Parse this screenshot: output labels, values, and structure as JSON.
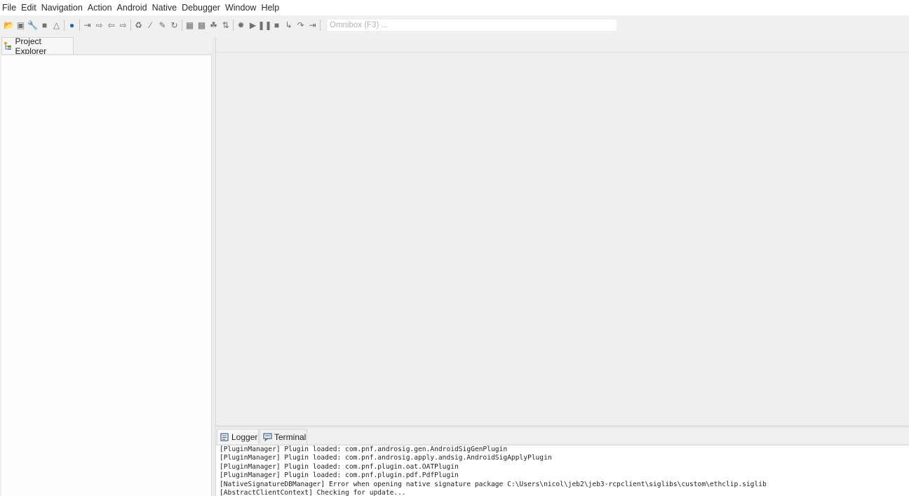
{
  "menu": {
    "items": [
      {
        "label": "File"
      },
      {
        "label": "Edit"
      },
      {
        "label": "Navigation"
      },
      {
        "label": "Action"
      },
      {
        "label": "Android"
      },
      {
        "label": "Native"
      },
      {
        "label": "Debugger"
      },
      {
        "label": "Window"
      },
      {
        "label": "Help"
      }
    ]
  },
  "toolbar": {
    "icons": [
      "open-icon",
      "save-icon",
      "wrench-icon",
      "close-project-icon",
      "properties-icon",
      "globe-icon",
      "step-in-icon",
      "step-over-icon",
      "back-icon",
      "forward-icon",
      "rename-icon",
      "comment-icon",
      "edit-icon",
      "refresh-icon",
      "grid-icon",
      "graph-icon",
      "tree-icon",
      "sort-icon",
      "debug-icon",
      "run-icon",
      "pause-icon",
      "stop-icon",
      "step-into-icon",
      "step-over-debug-icon",
      "step-return-icon"
    ],
    "omnibox_placeholder": "Omnibox (F3) ..."
  },
  "project_explorer": {
    "tab_label": "Project Explorer"
  },
  "bottom_panel": {
    "tabs": [
      {
        "label": "Logger"
      },
      {
        "label": "Terminal"
      }
    ],
    "log_lines": [
      "[PluginManager] Plugin loaded: com.pnf.androsig.gen.AndroidSigGenPlugin",
      "[PluginManager] Plugin loaded: com.pnf.androsig.apply.andsig.AndroidSigApplyPlugin",
      "[PluginManager] Plugin loaded: com.pnf.plugin.oat.OATPlugin",
      "[PluginManager] Plugin loaded: com.pnf.plugin.pdf.PdfPlugin",
      "[NativeSignatureDBManager] Error when opening native signature package C:\\Users\\nicol\\jeb2\\jeb3-rcpclient\\siglibs\\custom\\ethclip.siglib",
      "[AbstractClientContext] Checking for update..."
    ]
  }
}
